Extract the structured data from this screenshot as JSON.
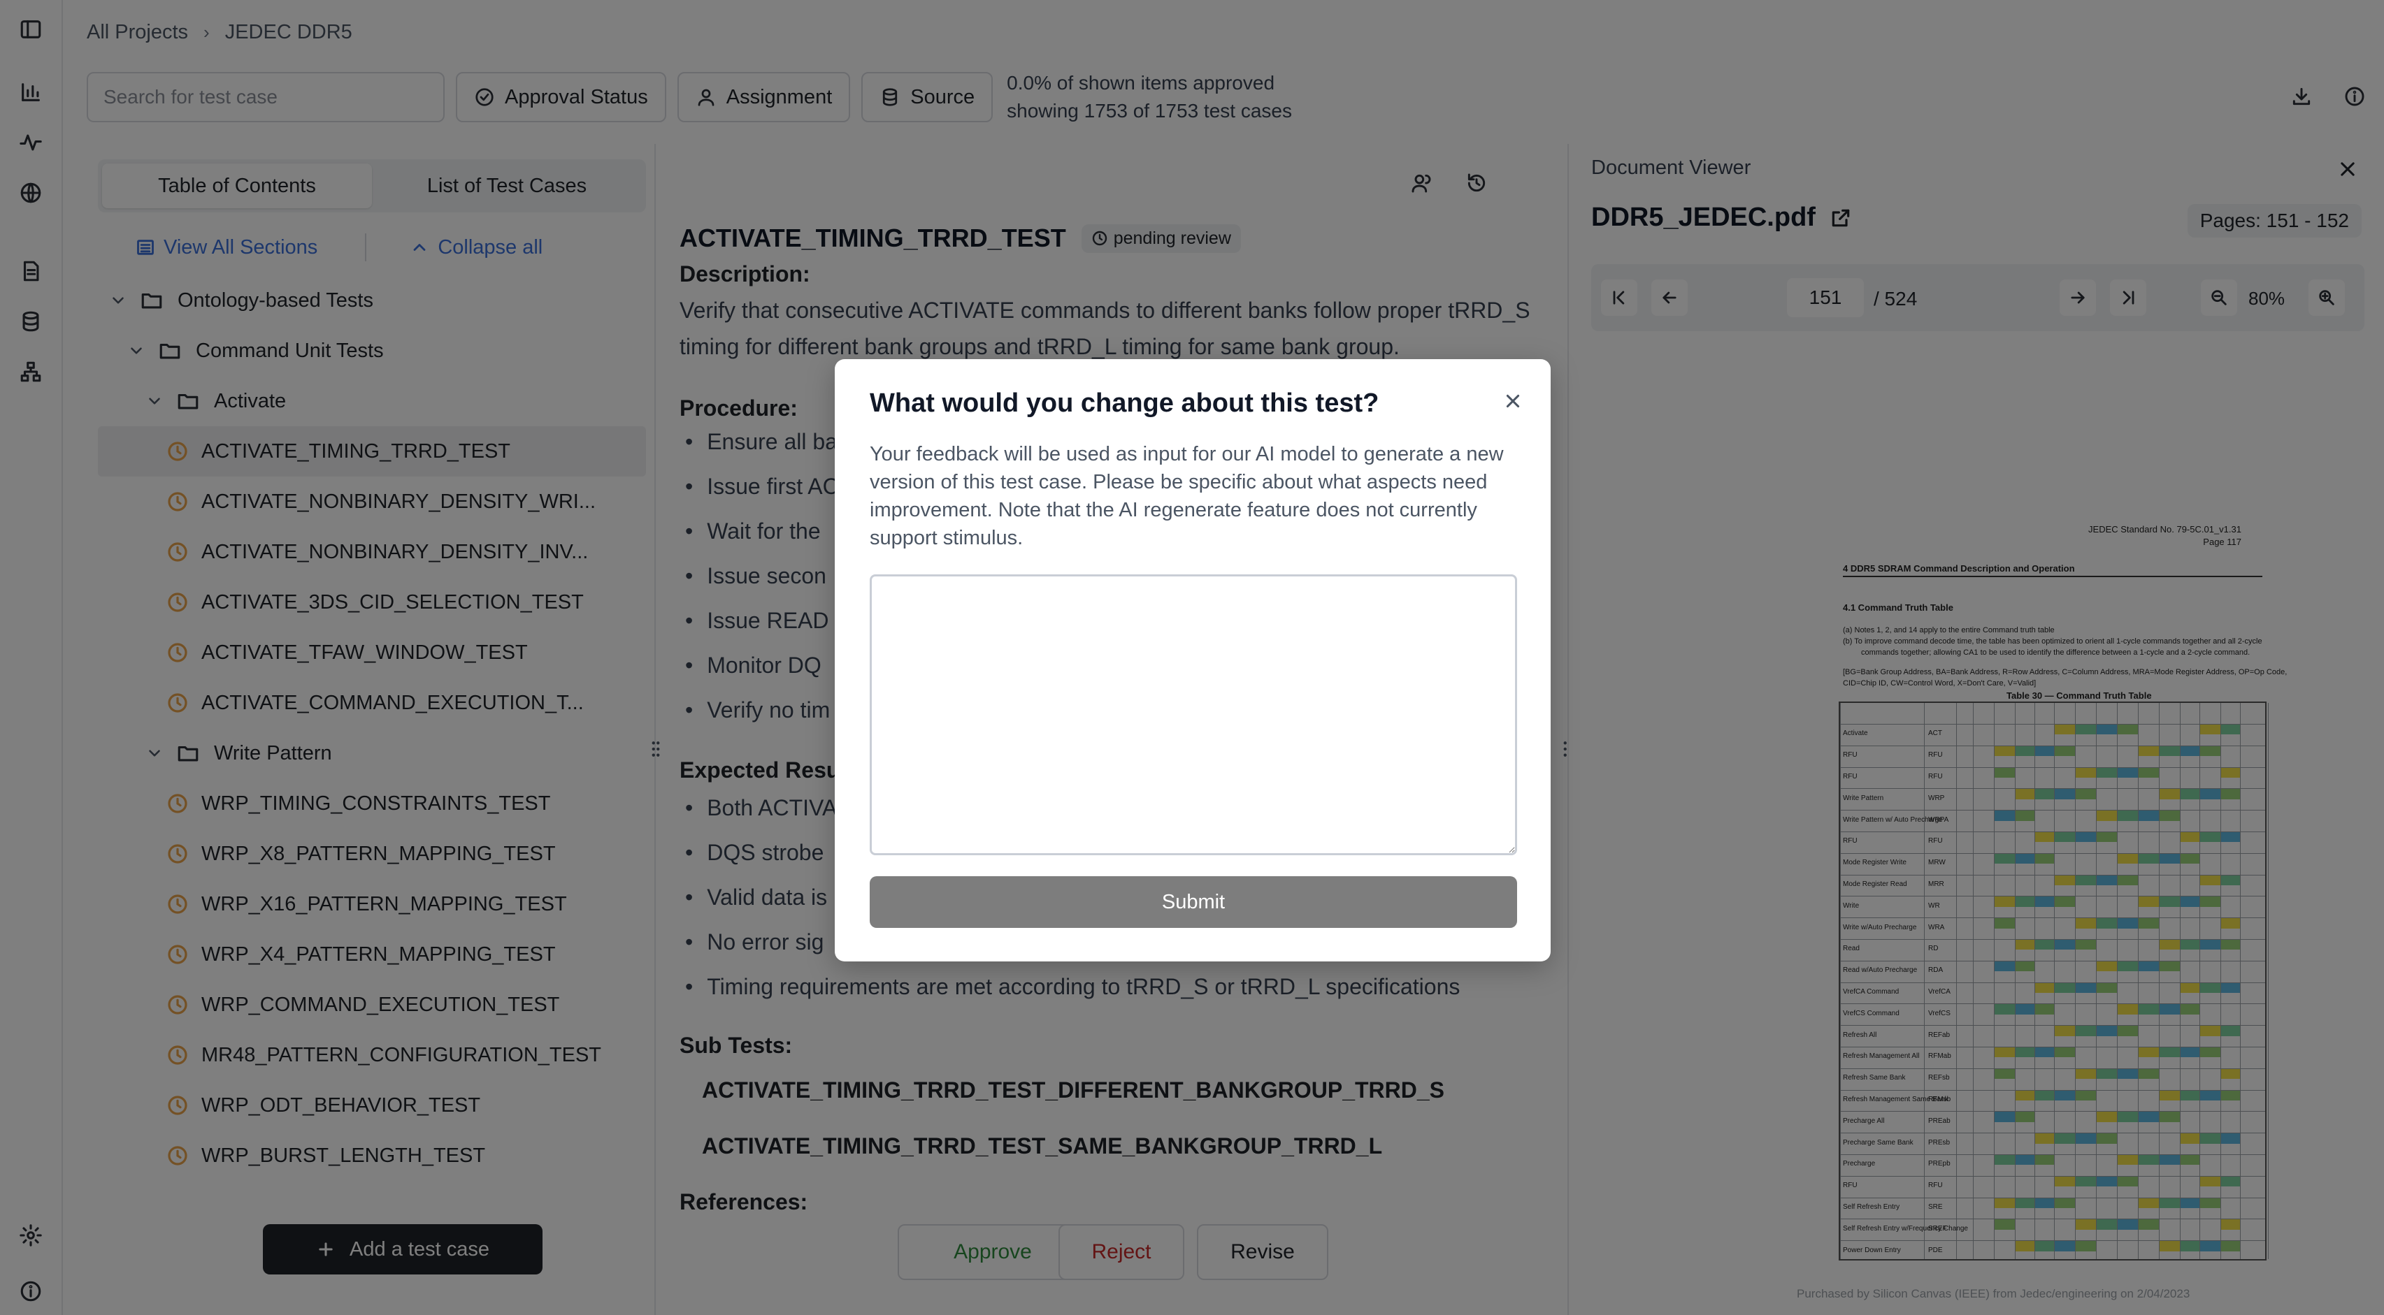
{
  "breadcrumb": {
    "root": "All Projects",
    "current": "JEDEC DDR5"
  },
  "toolbar": {
    "search_placeholder": "Search for test case",
    "approval_status": "Approval Status",
    "assignment": "Assignment",
    "source": "Source",
    "approved_pct": "0.0% of shown items approved",
    "showing_count": "showing 1753 of 1753 test cases"
  },
  "left_panel": {
    "tabs": [
      "Table of Contents",
      "List of Test Cases"
    ],
    "view_all": "View All Sections",
    "collapse_all": "Collapse all",
    "tree": [
      {
        "label": "Ontology-based Tests",
        "kind": "folder",
        "depth": 0
      },
      {
        "label": "Command Unit Tests",
        "kind": "folder",
        "depth": 1
      },
      {
        "label": "Activate",
        "kind": "folder",
        "depth": 2
      },
      {
        "label": "ACTIVATE_TIMING_TRRD_TEST",
        "kind": "test",
        "depth": 3,
        "selected": true
      },
      {
        "label": "ACTIVATE_NONBINARY_DENSITY_WRI...",
        "kind": "test",
        "depth": 3
      },
      {
        "label": "ACTIVATE_NONBINARY_DENSITY_INV...",
        "kind": "test",
        "depth": 3
      },
      {
        "label": "ACTIVATE_3DS_CID_SELECTION_TEST",
        "kind": "test",
        "depth": 3
      },
      {
        "label": "ACTIVATE_TFAW_WINDOW_TEST",
        "kind": "test",
        "depth": 3
      },
      {
        "label": "ACTIVATE_COMMAND_EXECUTION_T...",
        "kind": "test",
        "depth": 3
      },
      {
        "label": "Write Pattern",
        "kind": "folder",
        "depth": 2
      },
      {
        "label": "WRP_TIMING_CONSTRAINTS_TEST",
        "kind": "test",
        "depth": 3
      },
      {
        "label": "WRP_X8_PATTERN_MAPPING_TEST",
        "kind": "test",
        "depth": 3
      },
      {
        "label": "WRP_X16_PATTERN_MAPPING_TEST",
        "kind": "test",
        "depth": 3
      },
      {
        "label": "WRP_X4_PATTERN_MAPPING_TEST",
        "kind": "test",
        "depth": 3
      },
      {
        "label": "WRP_COMMAND_EXECUTION_TEST",
        "kind": "test",
        "depth": 3
      },
      {
        "label": "MR48_PATTERN_CONFIGURATION_TEST",
        "kind": "test",
        "depth": 3
      },
      {
        "label": "WRP_ODT_BEHAVIOR_TEST",
        "kind": "test",
        "depth": 3
      },
      {
        "label": "WRP_BURST_LENGTH_TEST",
        "kind": "test",
        "depth": 3
      }
    ],
    "add_button": "Add a test case"
  },
  "test_case": {
    "title": "ACTIVATE_TIMING_TRRD_TEST",
    "status": "pending review",
    "description_heading": "Description:",
    "description": "Verify that consecutive ACTIVATE commands to different banks follow proper tRRD_S timing for different bank groups and tRRD_L timing for same bank group.",
    "procedure_heading": "Procedure:",
    "procedure": [
      "Ensure all ba",
      "Issue first AC",
      "Wait for the",
      "Issue secon",
      "Issue READ",
      "Monitor DQ",
      "Verify no tim"
    ],
    "expected_heading": "Expected Resu",
    "expected": [
      "Both ACTIVA",
      "DQS strobe",
      "Valid data is",
      "No error sig",
      "Timing requirements are met according to tRRD_S or tRRD_L specifications"
    ],
    "subtests_heading": "Sub Tests:",
    "subtests": [
      "ACTIVATE_TIMING_TRRD_TEST_DIFFERENT_BANKGROUP_TRRD_S",
      "ACTIVATE_TIMING_TRRD_TEST_SAME_BANKGROUP_TRRD_L"
    ],
    "references_heading": "References:",
    "actions": {
      "approve": "Approve",
      "reject": "Reject",
      "revise": "Revise"
    }
  },
  "viewer": {
    "header": "Document Viewer",
    "filename": "DDR5_JEDEC.pdf",
    "pages": "Pages: 151 - 152",
    "current_page": "151",
    "total_pages": "/ 524",
    "zoom": "80%",
    "pdf": {
      "std": "JEDEC Standard No. 79-5C.01_v1.31",
      "page": "Page 117",
      "section": "4        DDR5 SDRAM Command Description and Operation",
      "subsection": "4.1        Command Truth Table",
      "note_a": "(a)   Notes 1, 2, and 14 apply to the entire Command truth table",
      "note_b": "(b)   To improve command decode time, the table has been optimized to orient all 1-cycle commands together and all 2-cycle",
      "note_b2": "commands together; allowing CA1 to be used to identify the difference between a 1-cycle and a 2-cycle command.",
      "legend1": "[BG=Bank Group Address, BA=Bank Address, R=Row Address, C=Column Address, MRA=Mode Register Address, OP=Op Code,",
      "legend2": "CID=Chip ID, CW=Control Word, X=Don't Care, V=Valid]",
      "table_title": "Table 30 — Command Truth Table",
      "functions": [
        "Activate",
        "RFU",
        "RFU",
        "Write Pattern",
        "Write Pattern w/ Auto Precharge",
        "RFU",
        "Mode Register Write",
        "Mode Register Read",
        "Write",
        "Write w/Auto Precharge",
        "Read",
        "Read w/Auto Precharge",
        "VrefCA Command",
        "VrefCS Command",
        "Refresh All",
        "Refresh Management All",
        "Refresh Same Bank",
        "Refresh Management Same Bank",
        "Precharge All",
        "Precharge Same Bank",
        "Precharge",
        "RFU",
        "Self Refresh Entry",
        "Self Refresh Entry w/Frequency Change",
        "Power Down Entry"
      ],
      "abbrev": [
        "ACT",
        "RFU",
        "RFU",
        "WRP",
        "WRPA",
        "RFU",
        "MRW",
        "MRR",
        "WR",
        "WRA",
        "RD",
        "RDA",
        "VrefCA",
        "VrefCS",
        "REFab",
        "RFMab",
        "REFsb",
        "RFMsb",
        "PREab",
        "PREsb",
        "PREpb",
        "RFU",
        "SRE",
        "SREF",
        "PDE"
      ],
      "watermark": "Purchased by Silicon Canvas (IEEE) from Jedec/engineering on 2/04/2023"
    }
  },
  "modal": {
    "title": "What would you change about this test?",
    "description": "Your feedback will be used as input for our AI model to generate a new version of this test case. Please be specific about what aspects need improvement. Note that the AI regenerate feature does not currently support stimulus.",
    "textarea_value": "",
    "submit": "Submit"
  },
  "colors": {
    "link": "#3a6fd8",
    "pending": "#e8a24a",
    "approve": "#2e8b3d",
    "reject": "#c62828",
    "overlay": "rgba(0,0,0,0.5)"
  }
}
